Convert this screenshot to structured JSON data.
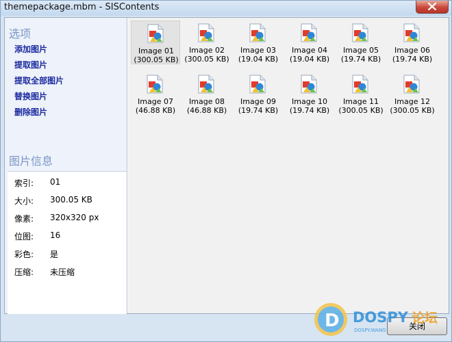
{
  "window": {
    "title": "themepackage.mbm - SISContents"
  },
  "sidebar": {
    "options_heading": "选项",
    "actions": [
      {
        "label": "添加图片"
      },
      {
        "label": "提取图片"
      },
      {
        "label": "提取全部图片"
      },
      {
        "label": "替换图片"
      },
      {
        "label": "删除图片"
      }
    ],
    "info_heading": "图片信息",
    "info": [
      {
        "key": "索引:",
        "value": "01"
      },
      {
        "key": "大小:",
        "value": "300.05 KB"
      },
      {
        "key": "像素:",
        "value": "320x320 px"
      },
      {
        "key": "位图:",
        "value": "16"
      },
      {
        "key": "彩色:",
        "value": "是"
      },
      {
        "key": "压缩:",
        "value": "未压缩"
      }
    ]
  },
  "images": [
    {
      "name": "Image 01",
      "size": "(300.05 KB)",
      "selected": true
    },
    {
      "name": "Image 02",
      "size": "(300.05 KB)"
    },
    {
      "name": "Image 03",
      "size": "(19.04 KB)"
    },
    {
      "name": "Image 04",
      "size": "(19.04 KB)"
    },
    {
      "name": "Image 05",
      "size": "(19.74 KB)"
    },
    {
      "name": "Image 06",
      "size": "(19.74 KB)"
    },
    {
      "name": "Image 07",
      "size": "(46.88 KB)"
    },
    {
      "name": "Image 08",
      "size": "(46.88 KB)"
    },
    {
      "name": "Image 09",
      "size": "(19.74 KB)"
    },
    {
      "name": "Image 10",
      "size": "(19.74 KB)"
    },
    {
      "name": "Image 11",
      "size": "(300.05 KB)"
    },
    {
      "name": "Image 12",
      "size": "(300.05 KB)"
    }
  ],
  "footer": {
    "close_label": "关闭"
  },
  "watermark": {
    "brand": "DOSPY",
    "suffix": "论坛",
    "sub": "DOSPY.WANG"
  },
  "colors": {
    "link": "#1b2aa0",
    "heading": "#7a96c8",
    "close_red": "#c8473a"
  },
  "icons": {
    "close": "close-icon",
    "image_file": "image-file-icon",
    "watermark_logo": "dospy-logo"
  }
}
